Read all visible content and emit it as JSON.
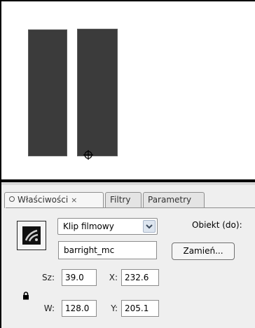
{
  "properties": {
    "tabs": [
      {
        "label": "Właściwości"
      },
      {
        "label": "Filtry"
      },
      {
        "label": "Parametry"
      }
    ],
    "close_glyph": "×",
    "symbol_type": "Klip filmowy",
    "instance_name": "barright_mc",
    "object_label": "Obiekt (do):",
    "swap_button": "Zamień...",
    "width_label": "Sz:",
    "width_value": "39.0",
    "x_label": "X:",
    "x_value": "232.6",
    "height_label": "W:",
    "height_value": "128.0",
    "y_label": "Y:",
    "y_value": "205.1"
  },
  "colors": {
    "bar_fill": "#3b3b3b",
    "panel_bg": "#efefef"
  },
  "icons": {
    "registration_point": "crosshair-circle-icon",
    "symbol": "movie-clip-icon",
    "lock": "lock-icon",
    "dropdown": "chevron-down-icon"
  }
}
